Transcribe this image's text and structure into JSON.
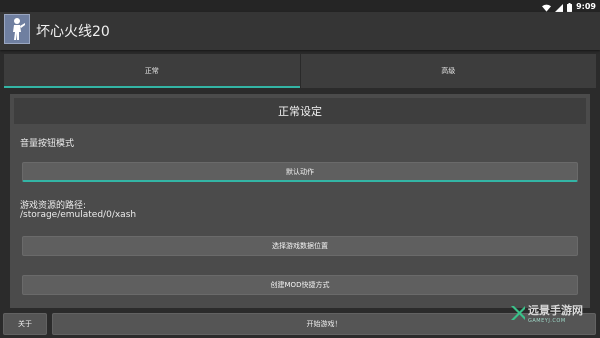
{
  "status": {
    "time": "9:09"
  },
  "app": {
    "title": "坏心火线20"
  },
  "tabs": [
    {
      "label": "正常",
      "active": true
    },
    {
      "label": "高级",
      "active": false
    }
  ],
  "main": {
    "section_title": "正常设定",
    "volume_label": "音量按钮模式",
    "volume_button": "默认动作",
    "path_label": "游戏资源的路径:",
    "path_value": "/storage/emulated/0/xash",
    "select_data_button": "选择游戏数据位置",
    "create_mod_button": "创建MOD快捷方式"
  },
  "bottom": {
    "about_button": "关于",
    "start_button": "开始游戏！"
  },
  "watermark": {
    "text": "远景手游网",
    "sub": "GAMEYJ.COM"
  },
  "colors": {
    "accent": "#33b5a5",
    "watermark_green": "#3ac28a"
  },
  "icons": [
    "wifi-icon",
    "signal-icon",
    "battery-icon",
    "app-logo-icon"
  ]
}
